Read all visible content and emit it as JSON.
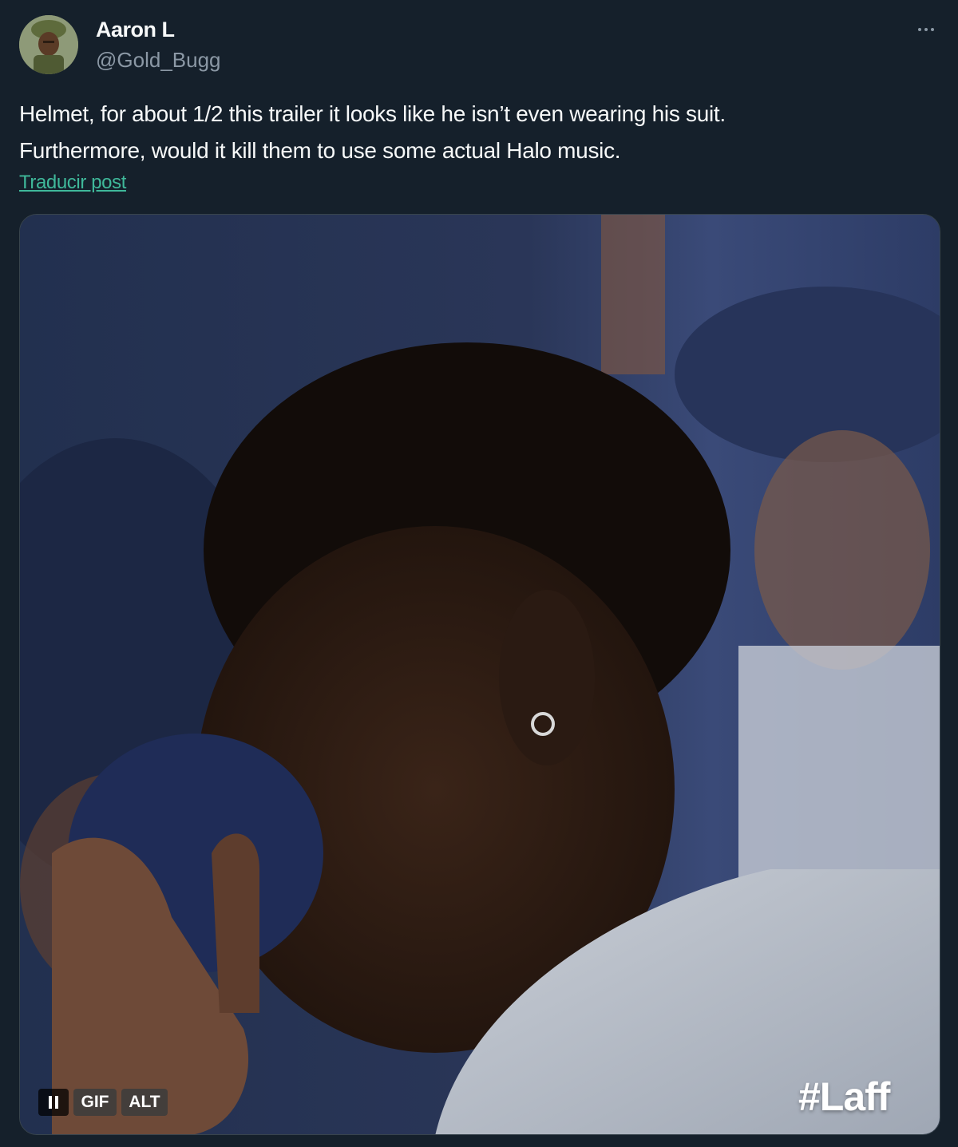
{
  "author": {
    "display_name": "Aaron L",
    "handle": "@Gold_Bugg"
  },
  "tweet": {
    "lines": [
      "Helmet, for about 1/2 this trailer it looks like he isn’t even wearing his suit.",
      "Furthermore, would it kill them to use some actual Halo music."
    ],
    "translate_label": "Traducir post"
  },
  "media": {
    "type": "gif",
    "gif_badge": "GIF",
    "alt_badge": "ALT",
    "watermark": "#Laff"
  },
  "icons": {
    "more": "more-horizontal-icon",
    "pause": "pause-icon"
  },
  "colors": {
    "background": "#15202b",
    "secondary_text": "#8b98a5",
    "link": "#3fb89a"
  }
}
